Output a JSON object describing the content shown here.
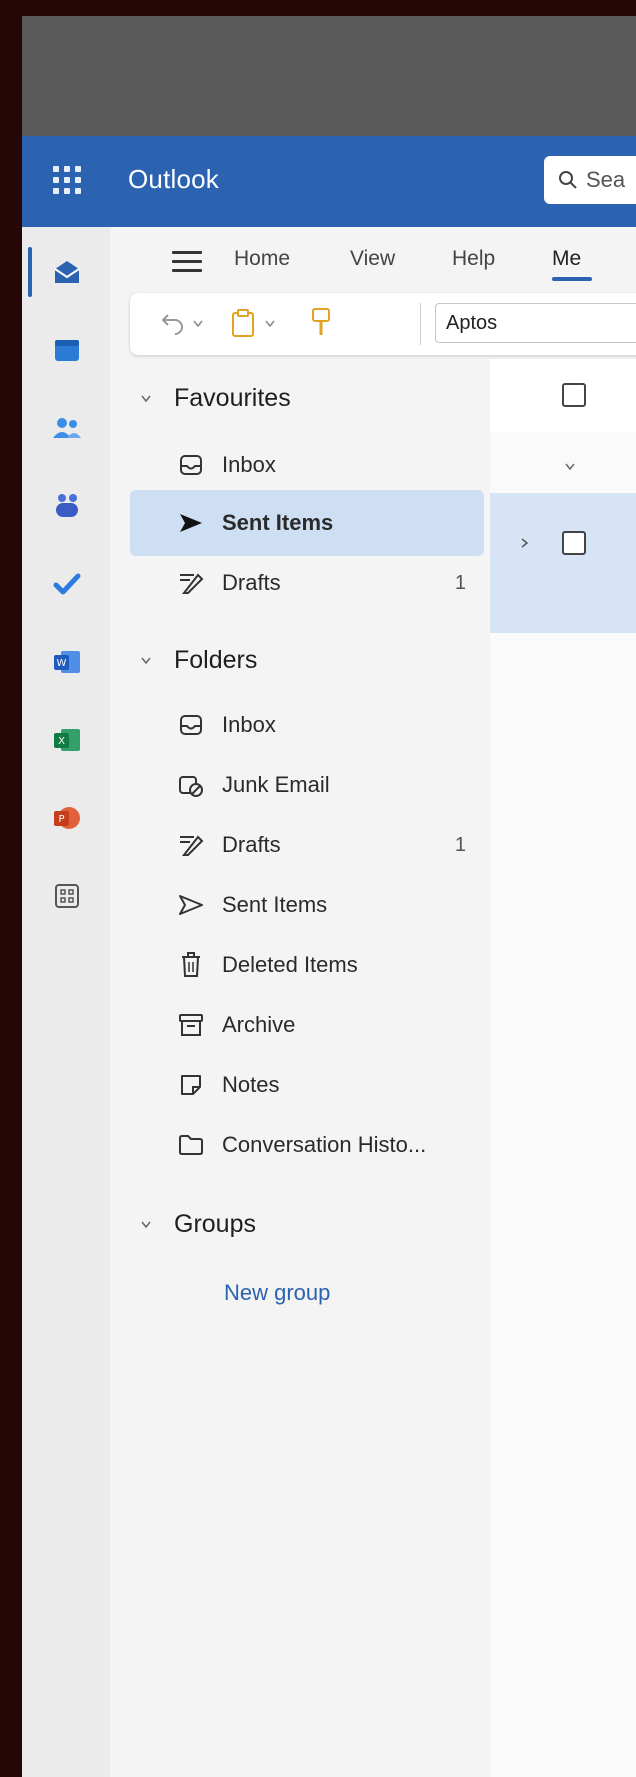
{
  "app": {
    "title": "Outlook"
  },
  "search": {
    "placeholder": "Sea"
  },
  "tabs": [
    "Home",
    "View",
    "Help",
    "Me"
  ],
  "ribbon": {
    "font_name": "Aptos"
  },
  "nav": {
    "favourites": {
      "label": "Favourites",
      "items": [
        {
          "label": "Inbox",
          "icon": "inbox-icon",
          "count": ""
        },
        {
          "label": "Sent Items",
          "icon": "send-icon",
          "count": ""
        },
        {
          "label": "Drafts",
          "icon": "drafts-icon",
          "count": "1"
        }
      ]
    },
    "folders": {
      "label": "Folders",
      "items": [
        {
          "label": "Inbox",
          "icon": "inbox-icon",
          "count": ""
        },
        {
          "label": "Junk Email",
          "icon": "junk-icon",
          "count": ""
        },
        {
          "label": "Drafts",
          "icon": "drafts-icon",
          "count": "1"
        },
        {
          "label": "Sent Items",
          "icon": "send-icon",
          "count": ""
        },
        {
          "label": "Deleted Items",
          "icon": "trash-icon",
          "count": ""
        },
        {
          "label": "Archive",
          "icon": "archive-icon",
          "count": ""
        },
        {
          "label": "Notes",
          "icon": "notes-icon",
          "count": ""
        },
        {
          "label": "Conversation Histo...",
          "icon": "folder-icon",
          "count": ""
        }
      ]
    },
    "groups": {
      "label": "Groups",
      "new_group": "New group"
    }
  },
  "colors": {
    "accent": "#2b63b0",
    "selected": "#cfdff3"
  }
}
